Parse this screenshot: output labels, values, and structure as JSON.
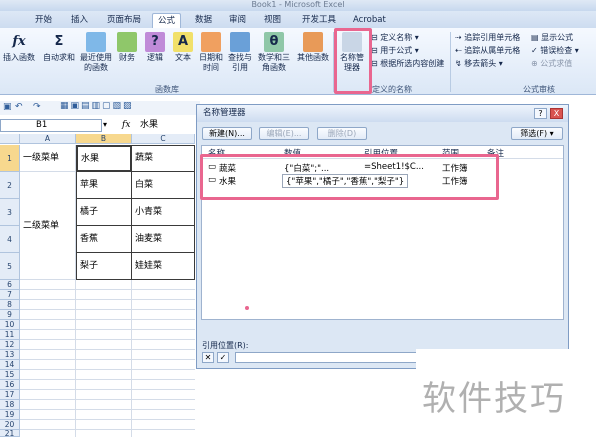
{
  "window": {
    "title": "Book1 - Microsoft Excel"
  },
  "tabs": [
    "开始",
    "插入",
    "页面布局",
    "公式",
    "数据",
    "审阅",
    "视图",
    "开发工具",
    "Acrobat"
  ],
  "active_tab": "公式",
  "ribbon": {
    "insert_function": "插入函数",
    "autosum": "自动求和",
    "recent": "最近使用的函数",
    "financial": "财务",
    "logical": "逻辑",
    "text": "文本",
    "datetime": "日期和时间",
    "lookup": "查找与引用",
    "math": "数学和三角函数",
    "other": "其他函数",
    "library_group": "函数库",
    "name_manager": "名称管理器",
    "define_name": "定义名称",
    "use_in_formula": "用于公式",
    "create_from_selection": "根据所选内容创建",
    "names_group": "定义的名称",
    "trace_precedents": "追踪引用单元格",
    "trace_dependents": "追踪从属单元格",
    "remove_arrows": "移去箭头",
    "show_formulas": "显示公式",
    "error_checking": "错误检查",
    "evaluate_formula": "公式求值",
    "audit_group": "公式审核"
  },
  "formula_bar": {
    "cell_ref": "B1",
    "fx": "fx",
    "value": "水果"
  },
  "sheet": {
    "columns": [
      "A",
      "B",
      "C"
    ],
    "rows": [
      "1",
      "2",
      "3",
      "4",
      "5",
      "6",
      "7",
      "8",
      "9",
      "10",
      "11",
      "12",
      "13",
      "14",
      "15",
      "16",
      "17",
      "18",
      "19",
      "20",
      "21",
      "22",
      "23",
      "24",
      "25",
      "26",
      "27"
    ],
    "a1": "一级菜单",
    "a3": "二级菜单",
    "b": [
      "水果",
      "苹果",
      "橘子",
      "香蕉",
      "梨子"
    ],
    "c": [
      "蔬菜",
      "白菜",
      "小青菜",
      "油麦菜",
      "娃娃菜"
    ]
  },
  "dialog": {
    "title": "名称管理器",
    "help": "?",
    "close": "X",
    "new_button": "新建(N)...",
    "edit_button": "编辑(E)...",
    "delete_button": "删除(D)",
    "filter_button": "筛选(F)",
    "headers": [
      "名称",
      "数值",
      "引用位置",
      "范围",
      "备注"
    ],
    "items": [
      {
        "name": "蔬菜",
        "value": "{\"白菜\";\"...",
        "ref": "=Sheet1!$C...",
        "scope": "工作簿",
        "note": ""
      },
      {
        "name": "水果",
        "value": "{\"苹果\",\"橘子\",\"香蕉\",\"梨子\"}",
        "ref": "",
        "scope": "工作簿",
        "note": ""
      }
    ],
    "ref_label": "引用位置(R):"
  },
  "watermark": "软件技巧",
  "colors": {
    "highlight": "#e9668f",
    "ribbon_bg": "#dbe7f6"
  }
}
